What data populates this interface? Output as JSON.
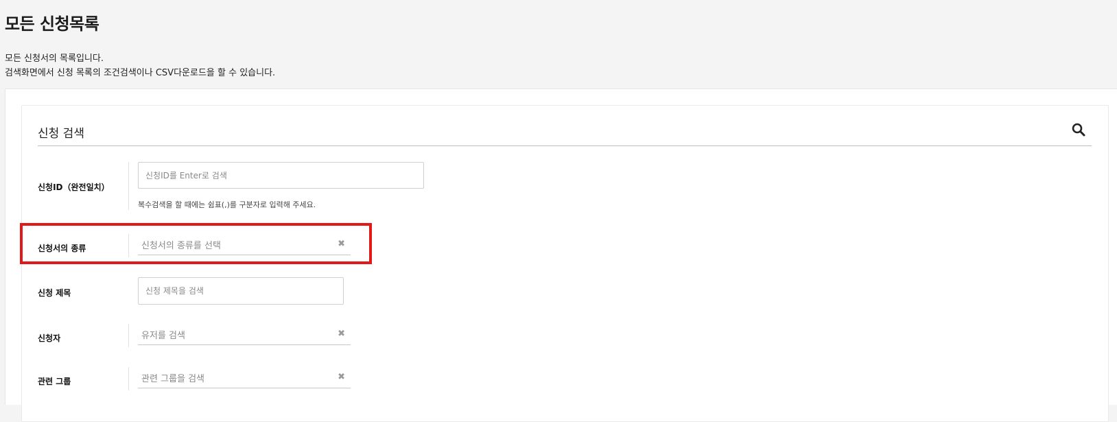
{
  "header": {
    "title": "모든 신청목록",
    "description_line1": "모든 신청서의 목록입니다.",
    "description_line2": "검색화면에서 신청 목록의 조건검색이나 CSV다운로드을 할 수 있습니다."
  },
  "search_panel": {
    "title": "신청 검색",
    "toggle_icon": "search-icon",
    "fields": {
      "request_id": {
        "label": "신청ID（완전일치）",
        "placeholder": "신청ID를 Enter로 검색",
        "value": "",
        "help": "복수검색을 할 때에는 쉼표(,)를 구분자로 입력해 주세요."
      },
      "request_type": {
        "label": "신청서의 종류",
        "placeholder": "신청서의 종류를 선택",
        "clear_icon": "close-icon"
      },
      "request_title": {
        "label": "신청 제목",
        "placeholder": "신청 제목을 검색",
        "value": ""
      },
      "applicant": {
        "label": "신청자",
        "placeholder": "유저를 검색",
        "clear_icon": "close-icon"
      },
      "related_group": {
        "label": "관련 그룹",
        "placeholder": "관련 그룹을 검색",
        "clear_icon": "close-icon"
      }
    }
  },
  "colors": {
    "highlight": "#e11919",
    "background": "#f4f4f4",
    "panel": "#ffffff"
  }
}
